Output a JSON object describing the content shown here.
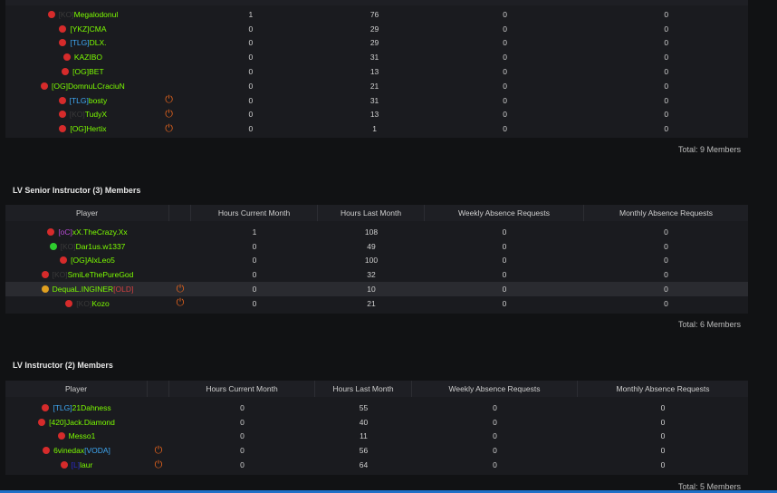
{
  "colors": {
    "online": "#2ecc2e",
    "offline": "#d62b2b",
    "away": "#e0a020",
    "power": "#e8651d",
    "name": "#7CFC00"
  },
  "top_table": {
    "rows": [
      {
        "status": "offline",
        "tag": "[KO]",
        "tag_color": "#3a3a3a",
        "name": "Megalodonul",
        "power": false,
        "hcm": "1",
        "hlm": "76",
        "war": "0",
        "mar": "0"
      },
      {
        "status": "offline",
        "tag": "[YKZ]",
        "tag_color": "#7CFC00",
        "name": "CMA",
        "power": false,
        "hcm": "0",
        "hlm": "29",
        "war": "0",
        "mar": "0"
      },
      {
        "status": "offline",
        "tag": "[TLG]",
        "tag_color": "#3fa9f5",
        "name": "DLX.",
        "power": false,
        "hcm": "0",
        "hlm": "29",
        "war": "0",
        "mar": "0"
      },
      {
        "status": "offline",
        "tag": "",
        "tag_color": "#7CFC00",
        "name": "KAZIBO",
        "power": false,
        "hcm": "0",
        "hlm": "31",
        "war": "0",
        "mar": "0"
      },
      {
        "status": "offline",
        "tag": "[OG]",
        "tag_color": "#7CFC00",
        "name": "BET",
        "power": false,
        "hcm": "0",
        "hlm": "13",
        "war": "0",
        "mar": "0"
      },
      {
        "status": "offline",
        "tag": "[OG]",
        "tag_color": "#7CFC00",
        "name": "DomnuLCraciuN",
        "power": false,
        "hcm": "0",
        "hlm": "21",
        "war": "0",
        "mar": "0"
      },
      {
        "status": "offline",
        "tag": "[TLG]",
        "tag_color": "#3fa9f5",
        "name": "bosty",
        "power": true,
        "hcm": "0",
        "hlm": "31",
        "war": "0",
        "mar": "0"
      },
      {
        "status": "offline",
        "tag": "[KO]",
        "tag_color": "#3a3a3a",
        "name": "TudyX",
        "power": true,
        "hcm": "0",
        "hlm": "13",
        "war": "0",
        "mar": "0"
      },
      {
        "status": "offline",
        "tag": "[OG]",
        "tag_color": "#7CFC00",
        "name": "Hertix",
        "power": true,
        "hcm": "0",
        "hlm": "1",
        "war": "0",
        "mar": "0"
      }
    ],
    "total": "Total: 9 Members"
  },
  "senior": {
    "title": "LV Senior Instructor (3) Members",
    "headers": {
      "player": "Player",
      "hcm": "Hours Current Month",
      "hlm": "Hours Last Month",
      "war": "Weekly Absence Requests",
      "mar": "Monthly Absence Requests"
    },
    "rows": [
      {
        "status": "offline",
        "tag": "[oC]",
        "tag_color": "#b84bd6",
        "name": "xX.TheCrazy.Xx",
        "power": false,
        "hcm": "1",
        "hlm": "108",
        "war": "0",
        "mar": "0"
      },
      {
        "status": "online",
        "tag": "[KO]",
        "tag_color": "#3a3a3a",
        "name": "Dar1us.w1337",
        "power": false,
        "hcm": "0",
        "hlm": "49",
        "war": "0",
        "mar": "0"
      },
      {
        "status": "offline",
        "tag": "[OG]",
        "tag_color": "#7CFC00",
        "name": "AlxLeo5",
        "power": false,
        "hcm": "0",
        "hlm": "100",
        "war": "0",
        "mar": "0"
      },
      {
        "status": "offline",
        "tag": "[KO]",
        "tag_color": "#3a3a3a",
        "name": "SmiLeThePureGod",
        "power": false,
        "hcm": "0",
        "hlm": "32",
        "war": "0",
        "mar": "0"
      },
      {
        "status": "away",
        "tag": "",
        "tag_color": "#7CFC00",
        "name": "DequaL.INGINER",
        "suffix": "[OLD]",
        "suffix_color": "#d44040",
        "power": true,
        "highlight": true,
        "hcm": "0",
        "hlm": "10",
        "war": "0",
        "mar": "0"
      },
      {
        "status": "offline",
        "tag": "[KO]",
        "tag_color": "#3a3a3a",
        "name": "Kozo",
        "power": true,
        "hcm": "0",
        "hlm": "21",
        "war": "0",
        "mar": "0"
      }
    ],
    "total": "Total: 6 Members"
  },
  "instructor": {
    "title": "LV Instructor (2) Members",
    "headers": {
      "player": "Player",
      "hcm": "Hours Current Month",
      "hlm": "Hours Last Month",
      "war": "Weekly Absence Requests",
      "mar": "Monthly Absence Requests"
    },
    "rows": [
      {
        "status": "offline",
        "tag": "[TLG]",
        "tag_color": "#3fa9f5",
        "name": "21Dahness",
        "power": false,
        "hcm": "0",
        "hlm": "55",
        "war": "0",
        "mar": "0"
      },
      {
        "status": "offline",
        "tag": "[420]",
        "tag_color": "#7CFC00",
        "name": "Jack.Diamond",
        "power": false,
        "hcm": "0",
        "hlm": "40",
        "war": "0",
        "mar": "0"
      },
      {
        "status": "offline",
        "tag": "",
        "tag_color": "#7CFC00",
        "name": "Messo1",
        "power": false,
        "hcm": "0",
        "hlm": "11",
        "war": "0",
        "mar": "0"
      },
      {
        "status": "offline",
        "tag": "",
        "tag_color": "#7CFC00",
        "name": "6vinedax",
        "suffix": "[VODA]",
        "suffix_color": "#3fa9f5",
        "power": true,
        "hcm": "0",
        "hlm": "56",
        "war": "0",
        "mar": "0"
      },
      {
        "status": "offline",
        "tag": "[L]",
        "tag_color": "#2a2ad0",
        "name": "laur",
        "power": true,
        "hcm": "0",
        "hlm": "64",
        "war": "0",
        "mar": "0"
      }
    ],
    "total": "Total: 5 Members"
  }
}
